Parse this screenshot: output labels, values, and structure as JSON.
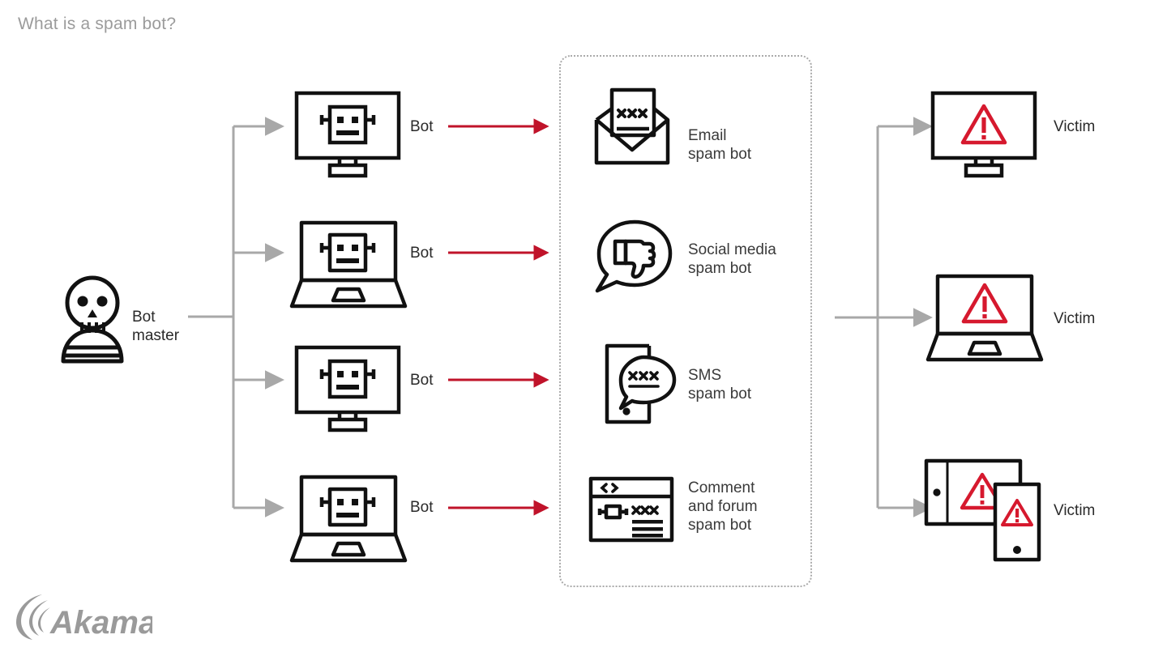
{
  "page": {
    "title": "What is a spam bot?",
    "background_color": "#ffffff",
    "title_color": "#9b9b9b"
  },
  "brand": {
    "logo_name": "Akamai",
    "logo_color": "#9a9a9a"
  },
  "colors": {
    "stroke_dark": "#111111",
    "accent_red": "#c0132a",
    "connector_gray": "#a8a8a8",
    "label_dark": "#2a2a2a",
    "dotted_border": "#aaaaaa"
  },
  "source": {
    "label": "Bot\nmaster",
    "icon": "skull-icon"
  },
  "bots": [
    {
      "label": "Bot",
      "icon": "desktop-robot-icon",
      "arrow": "red-arrow-right"
    },
    {
      "label": "Bot",
      "icon": "laptop-robot-icon",
      "arrow": "red-arrow-right"
    },
    {
      "label": "Bot",
      "icon": "desktop-robot-icon",
      "arrow": "red-arrow-right"
    },
    {
      "label": "Bot",
      "icon": "laptop-robot-icon",
      "arrow": "red-arrow-right"
    }
  ],
  "spam_types": [
    {
      "label": "Email\nspam bot",
      "icon": "envelope-xxx-icon"
    },
    {
      "label": "Social media\nspam bot",
      "icon": "speech-bubble-thumbs-down-icon"
    },
    {
      "label": "SMS\nspam bot",
      "icon": "phone-speech-bubble-xxx-icon"
    },
    {
      "label": "Comment\nand forum\nspam bot",
      "icon": "browser-window-comment-icon"
    }
  ],
  "victims": [
    {
      "label": "Victim",
      "icon": "desktop-warning-icon"
    },
    {
      "label": "Victim",
      "icon": "laptop-warning-icon"
    },
    {
      "label": "Victim",
      "icon": "tablet-phone-warning-icon"
    }
  ]
}
